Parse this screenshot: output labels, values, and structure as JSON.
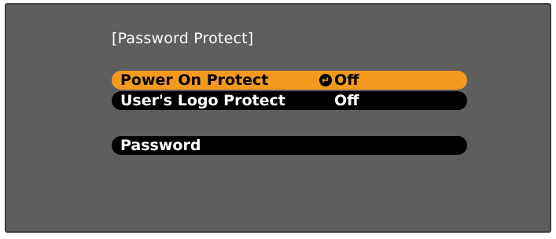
{
  "menu": {
    "title": "[Password Protect]",
    "items": [
      {
        "label": "Power On Protect",
        "value": "Off",
        "selected": true,
        "icon": "enter-icon"
      },
      {
        "label": "User's Logo Protect",
        "value": "Off",
        "selected": false
      },
      {
        "label": "Password",
        "value": "",
        "selected": false
      }
    ]
  },
  "colors": {
    "panel_bg": "#5e5e5e",
    "highlight": "#f39a1e",
    "row_bg": "#000000",
    "text": "#ffffff"
  }
}
